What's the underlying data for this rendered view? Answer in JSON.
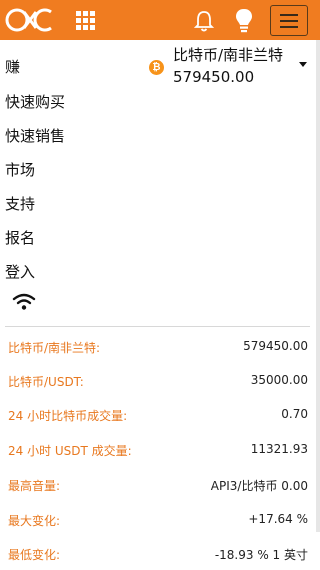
{
  "header": {
    "logo_icon": "coin-exchange-logo-icon",
    "apps_icon": "grid-icon",
    "notifications_icon": "bell-icon",
    "tips_icon": "lightbulb-icon",
    "menu_icon": "hamburger-icon",
    "accent_color": "#f07c20"
  },
  "nav": {
    "items": [
      "赚",
      "快速购买",
      "快速销售",
      "市场",
      "支持",
      "报名",
      "登入"
    ],
    "status_icon": "wifi-icon"
  },
  "ticker": {
    "coin_icon": "bitcoin-icon",
    "pair": "比特币/南非兰特",
    "price": "579450.00",
    "dropdown_icon": "caret-down-icon"
  },
  "stats": [
    {
      "label": "比特币/南非兰特:",
      "value": "579450.00"
    },
    {
      "label": "比特币/USDT:",
      "value": "35000.00"
    },
    {
      "label": "24 小时比特币成交量:",
      "value": "0.70"
    },
    {
      "label": "24 小时 USDT 成交量:",
      "value": "11321.93"
    },
    {
      "label": "最高音量:",
      "value": "API3/比特币 0.00"
    },
    {
      "label": "最大变化:",
      "value": "+17.64 %"
    },
    {
      "label": "最低变化:",
      "value": "-18.93 % 1 英寸"
    }
  ]
}
